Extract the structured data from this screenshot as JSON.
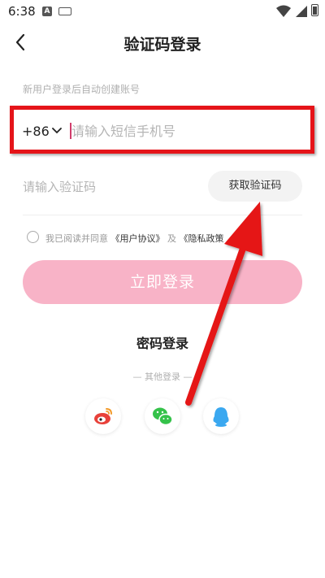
{
  "status_bar": {
    "time": "6:38",
    "notification_letter": "A"
  },
  "header": {
    "back_icon": "chevron-left-icon",
    "title": "验证码登录"
  },
  "form": {
    "new_user_hint": "新用户登录后自动创建账号",
    "country_code": "+86",
    "phone_placeholder": "请输入短信手机号",
    "code_placeholder": "请输入验证码",
    "get_code_label": "获取验证码"
  },
  "agreement": {
    "prefix": "我已阅读并同意",
    "user_agreement": "《用户协议》",
    "and": "及",
    "privacy_policy": "《隐私政策"
  },
  "login_button_label": "立即登录",
  "password_login_label": "密码登录",
  "other_login_label": "— 其他登录 —",
  "social_logins": [
    "weibo-icon",
    "wechat-icon",
    "qq-icon"
  ],
  "colors": {
    "accent_pink": "#f8b3c7",
    "highlight_red": "#e51419",
    "wechat_green": "#35c24a",
    "weibo_red": "#e8413a",
    "qq_blue": "#3aa8f0"
  }
}
